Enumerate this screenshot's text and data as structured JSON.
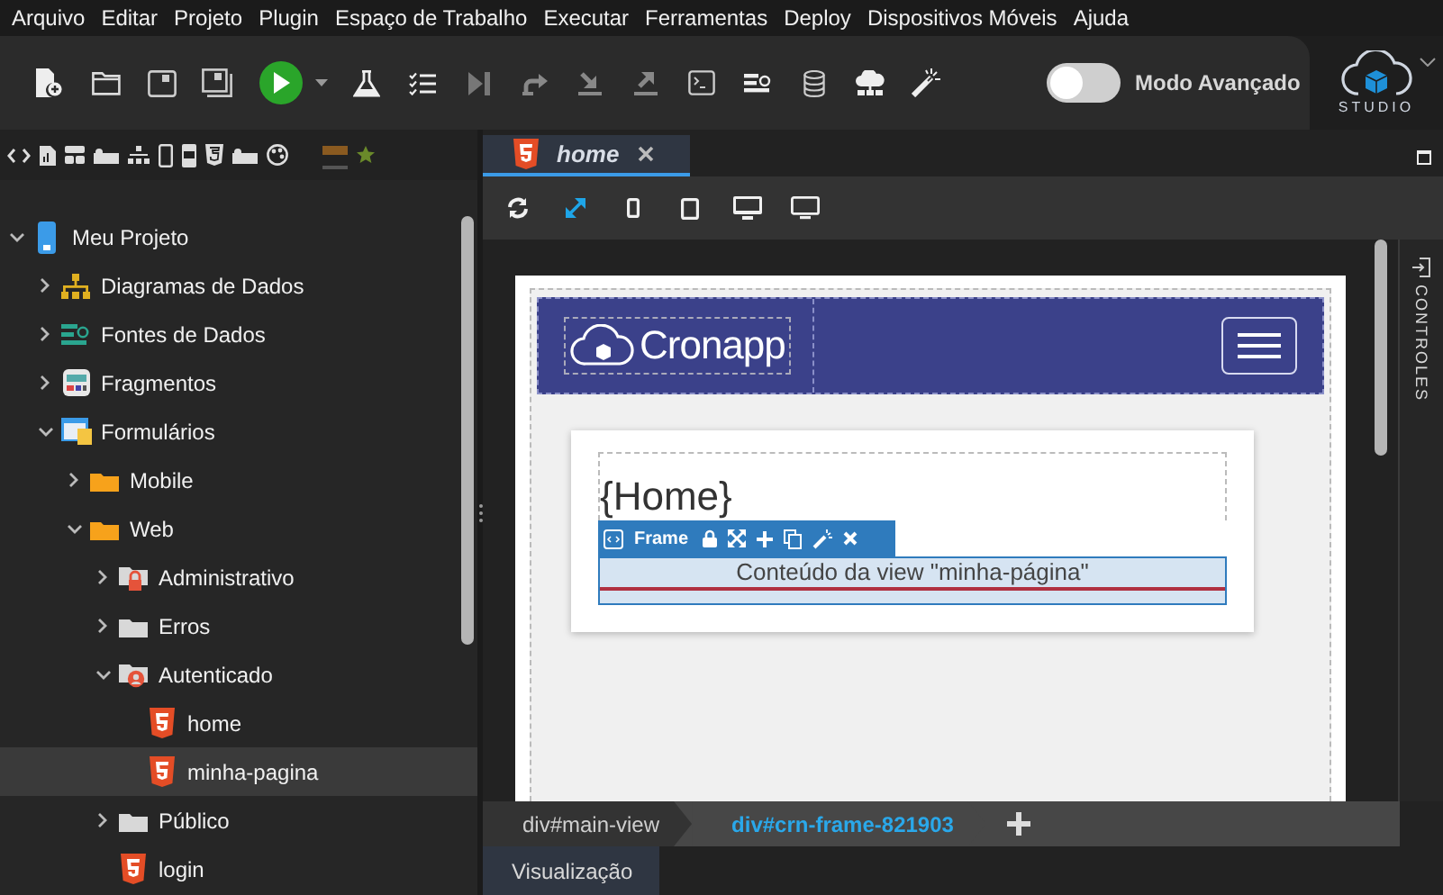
{
  "menu": [
    "Arquivo",
    "Editar",
    "Projeto",
    "Plugin",
    "Espaço de Trabalho",
    "Executar",
    "Ferramentas",
    "Deploy",
    "Dispositivos Móveis",
    "Ajuda"
  ],
  "advanced_mode": {
    "label": "Modo Avançado",
    "on": false
  },
  "logo": {
    "caption": "STUDIO"
  },
  "project_tree": [
    {
      "label": "Meu Projeto",
      "kind": "phone",
      "expanded": true,
      "selected": false,
      "children": [
        {
          "label": "Diagramas de Dados",
          "kind": "diagram",
          "expanded": false,
          "selected": false
        },
        {
          "label": "Fontes de Dados",
          "kind": "datasource",
          "expanded": false,
          "selected": false
        },
        {
          "label": "Fragmentos",
          "kind": "fragment",
          "expanded": false,
          "selected": false
        },
        {
          "label": "Formulários",
          "kind": "form",
          "expanded": true,
          "selected": false,
          "children": [
            {
              "label": "Mobile",
              "kind": "folder",
              "expanded": false,
              "selected": false
            },
            {
              "label": "Web",
              "kind": "folder",
              "expanded": true,
              "selected": false,
              "children": [
                {
                  "label": "Administrativo",
                  "kind": "folder-lock",
                  "expanded": false,
                  "selected": false
                },
                {
                  "label": "Erros",
                  "kind": "folder-grey",
                  "expanded": false,
                  "selected": false
                },
                {
                  "label": "Autenticado",
                  "kind": "folder-user",
                  "expanded": true,
                  "selected": false,
                  "children": [
                    {
                      "label": "home",
                      "kind": "html",
                      "selected": false
                    },
                    {
                      "label": "minha-pagina",
                      "kind": "html",
                      "selected": true
                    }
                  ]
                },
                {
                  "label": "Público",
                  "kind": "folder-grey",
                  "expanded": false,
                  "selected": false
                },
                {
                  "label": "login",
                  "kind": "html",
                  "selected": false
                }
              ]
            }
          ]
        }
      ]
    }
  ],
  "editor_tabs": [
    {
      "label": "home",
      "selected": true
    }
  ],
  "view_tools": [
    {
      "kind": "refresh",
      "selected": false
    },
    {
      "kind": "fit",
      "selected": true
    },
    {
      "kind": "phone",
      "selected": false
    },
    {
      "kind": "tablet",
      "selected": false
    },
    {
      "kind": "desktop",
      "selected": false
    },
    {
      "kind": "wide",
      "selected": false
    }
  ],
  "canvas": {
    "brand": "Cronapp",
    "heading": "{Home}",
    "frame_label": "Frame",
    "frame_content": "Conteúdo da view \"minha-página\""
  },
  "side_panel": {
    "label": "CONTROLES"
  },
  "breadcrumbs": [
    {
      "label": "div#main-view",
      "selected": false
    },
    {
      "label": "div#crn-frame-821903",
      "selected": true
    }
  ],
  "bottom_tabs": [
    {
      "label": "Visualização",
      "selected": true
    }
  ]
}
